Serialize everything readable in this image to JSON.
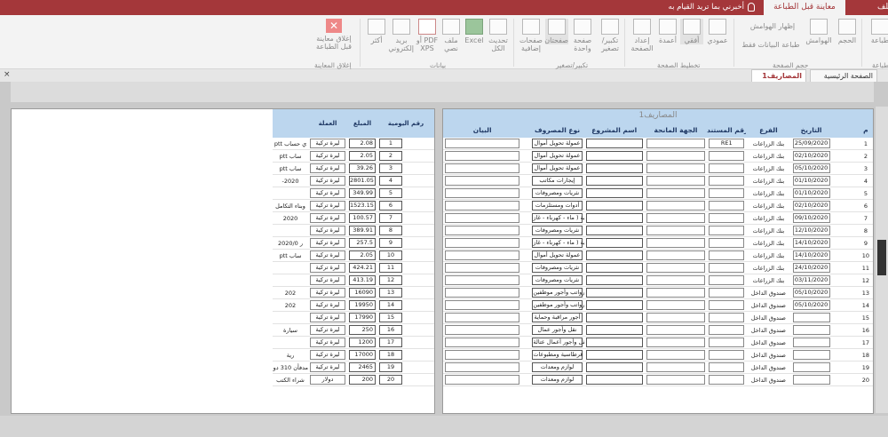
{
  "titlebar": {
    "active_tab": "معاينة قبل الطباعة",
    "file_tab": "ملف",
    "tell_me": "أخبرني بما تريد القيام به"
  },
  "ribbon": {
    "buttons": [
      {
        "label": "طباعة",
        "icon": "printer-icon"
      },
      {
        "label": "الحجم",
        "icon": "page-size-icon"
      },
      {
        "label": "الهوامش",
        "icon": "margins-icon"
      },
      {
        "label": "إظهار الهوامش",
        "icon": "checkbox-icon"
      },
      {
        "label": "طباعة البيانات فقط",
        "icon": "checkbox-icon"
      },
      {
        "label": "عمودي",
        "icon": "portrait-icon"
      },
      {
        "label": "أفقي",
        "icon": "landscape-icon"
      },
      {
        "label": "أعمدة",
        "icon": "columns-icon"
      },
      {
        "label": "إعداد الصفحة",
        "icon": "page-setup-icon"
      },
      {
        "label": "تكبير/تصغير",
        "icon": "zoom-icon"
      },
      {
        "label": "صفحة واحدة",
        "icon": "one-page-icon"
      },
      {
        "label": "صفحتان",
        "icon": "two-pages-icon"
      },
      {
        "label": "صفحات إضافية",
        "icon": "more-pages-icon"
      },
      {
        "label": "تحديث الكل",
        "icon": "refresh-icon"
      },
      {
        "label": "Excel",
        "icon": "excel-icon"
      },
      {
        "label": "ملف نصي",
        "icon": "text-file-icon"
      },
      {
        "label": "PDF أو XPS",
        "icon": "pdf-icon"
      },
      {
        "label": "بريد إلكتروني",
        "icon": "email-icon"
      },
      {
        "label": "أكثر",
        "icon": "more-icon"
      },
      {
        "label": "إغلاق معاينة قبل الطباعة",
        "icon": "close-preview-icon"
      }
    ],
    "groups": [
      "طباعة",
      "حجم الصفحة",
      "تخطيط الصفحة",
      "تكبير/تصغير",
      "بيانات",
      "إغلاق المعاينة"
    ]
  },
  "doc_tabs": [
    "الصفحة الرئيسية",
    "المصاريف1"
  ],
  "close_label": "×",
  "report": {
    "title": "المصاريف1",
    "headers": [
      "م",
      "التاريخ",
      "الفرع",
      "رقم المستند",
      "الجهة المانحة",
      "اسم المشروع",
      "نوع المصروف",
      "البيان"
    ],
    "rows": [
      {
        "n": "1",
        "date": "25/09/2020",
        "branch": "بنك الزراعات",
        "doc": "RE1",
        "type": "عمولة تحويل أموال"
      },
      {
        "n": "2",
        "date": "02/10/2020",
        "branch": "بنك الزراعات",
        "doc": "",
        "type": "عمولة تحويل أموال"
      },
      {
        "n": "3",
        "date": "05/10/2020",
        "branch": "بنك الزراعات",
        "doc": "",
        "type": "عمولة تحويل أموال"
      },
      {
        "n": "4",
        "date": "01/10/2020",
        "branch": "بنك الزراعات",
        "doc": "",
        "type": "إيجارات مكاتب"
      },
      {
        "n": "5",
        "date": "01/10/2020",
        "branch": "بنك الزراعات",
        "doc": "",
        "type": "نثريات ومصروفات"
      },
      {
        "n": "6",
        "date": "02/10/2020",
        "branch": "بنك الزراعات",
        "doc": "",
        "type": "أدوات ومستلزمات"
      },
      {
        "n": "7",
        "date": "09/10/2020",
        "branch": "بنك الزراعات",
        "doc": "",
        "type": "حكومية ( ماء - كهرباء - غاز"
      },
      {
        "n": "8",
        "date": "12/10/2020",
        "branch": "بنك الزراعات",
        "doc": "",
        "type": "نثريات ومصروفات"
      },
      {
        "n": "9",
        "date": "14/10/2020",
        "branch": "بنك الزراعات",
        "doc": "",
        "type": "حكومية ( ماء - كهرباء - غاز"
      },
      {
        "n": "10",
        "date": "14/10/2020",
        "branch": "بنك الزراعات",
        "doc": "",
        "type": "عمولة تحويل أموال"
      },
      {
        "n": "11",
        "date": "24/10/2020",
        "branch": "بنك الزراعات",
        "doc": "",
        "type": "نثريات ومصروفات"
      },
      {
        "n": "12",
        "date": "03/11/2020",
        "branch": "بنك الزراعات",
        "doc": "",
        "type": "نثريات ومصروفات"
      },
      {
        "n": "13",
        "date": "05/10/2020",
        "branch": "صندوق الداخل",
        "doc": "",
        "type": "رواتب وأجور موظفين"
      },
      {
        "n": "14",
        "date": "05/10/2020",
        "branch": "صندوق الداخل",
        "doc": "",
        "type": "رواتب وأجور موظفين"
      },
      {
        "n": "15",
        "date": "",
        "branch": "صندوق الداخل",
        "doc": "",
        "type": "أجور مراقبة وحماية"
      },
      {
        "n": "16",
        "date": "",
        "branch": "صندوق الداخل",
        "doc": "",
        "type": "نقل وأجور عمال"
      },
      {
        "n": "17",
        "date": "",
        "branch": "صندوق الداخل",
        "doc": "",
        "type": "نقل وأجور أعمال عتالة"
      },
      {
        "n": "18",
        "date": "",
        "branch": "صندوق الداخل",
        "doc": "",
        "type": "قرطاسية ومطبوعات"
      },
      {
        "n": "19",
        "date": "",
        "branch": "صندوق الداخل",
        "doc": "",
        "type": "لوازم ومعدات"
      },
      {
        "n": "20",
        "date": "",
        "branch": "صندوق الداخل",
        "doc": "",
        "type": "لوازم ومعدات"
      }
    ]
  },
  "report2": {
    "headers": [
      "رقم اليومية",
      "المبلغ",
      "العملة"
    ],
    "rows": [
      {
        "n": "1",
        "amount": "2.08",
        "currency": "ليرة تركية",
        "frag": "ي حساب ptt"
      },
      {
        "n": "2",
        "amount": "2.05",
        "currency": "ليرة تركية",
        "frag": "ساب ptt"
      },
      {
        "n": "3",
        "amount": "39.26",
        "currency": "ليرة تركية",
        "frag": "ساب ptt"
      },
      {
        "n": "4",
        "amount": "2801.05",
        "currency": "ليرة تركية",
        "frag": "2020-"
      },
      {
        "n": "5",
        "amount": "349.99",
        "currency": "ليرة تركية",
        "frag": ""
      },
      {
        "n": "6",
        "amount": "1523.15",
        "currency": "ليرة تركية",
        "frag": "وبناء التكامل"
      },
      {
        "n": "7",
        "amount": "100.57",
        "currency": "ليرة تركية",
        "frag": "2020"
      },
      {
        "n": "8",
        "amount": "389.91",
        "currency": "ليرة تركية",
        "frag": ""
      },
      {
        "n": "9",
        "amount": "257.5",
        "currency": "ليرة تركية",
        "frag": "ر 2020/0"
      },
      {
        "n": "10",
        "amount": "2.05",
        "currency": "ليرة تركية",
        "frag": "ساب ptt"
      },
      {
        "n": "11",
        "amount": "424.21",
        "currency": "ليرة تركية",
        "frag": ""
      },
      {
        "n": "12",
        "amount": "413.19",
        "currency": "ليرة تركية",
        "frag": ""
      },
      {
        "n": "13",
        "amount": "16090",
        "currency": "ليرة تركية",
        "frag": "202"
      },
      {
        "n": "14",
        "amount": "19950",
        "currency": "ليرة تركية",
        "frag": "202"
      },
      {
        "n": "15",
        "amount": "17990",
        "currency": "ليرة تركية",
        "frag": ""
      },
      {
        "n": "16",
        "amount": "250",
        "currency": "ليرة تركية",
        "frag": "سيارة"
      },
      {
        "n": "17",
        "amount": "1200",
        "currency": "ليرة تركية",
        "frag": ""
      },
      {
        "n": "18",
        "amount": "17000",
        "currency": "ليرة تركية",
        "frag": "رية"
      },
      {
        "n": "19",
        "amount": "2465",
        "currency": "ليرة تركية",
        "frag": "مدفأن 310 دولار"
      },
      {
        "n": "20",
        "amount": "200",
        "currency": "دولار",
        "frag": "شراء الكتب"
      }
    ]
  }
}
